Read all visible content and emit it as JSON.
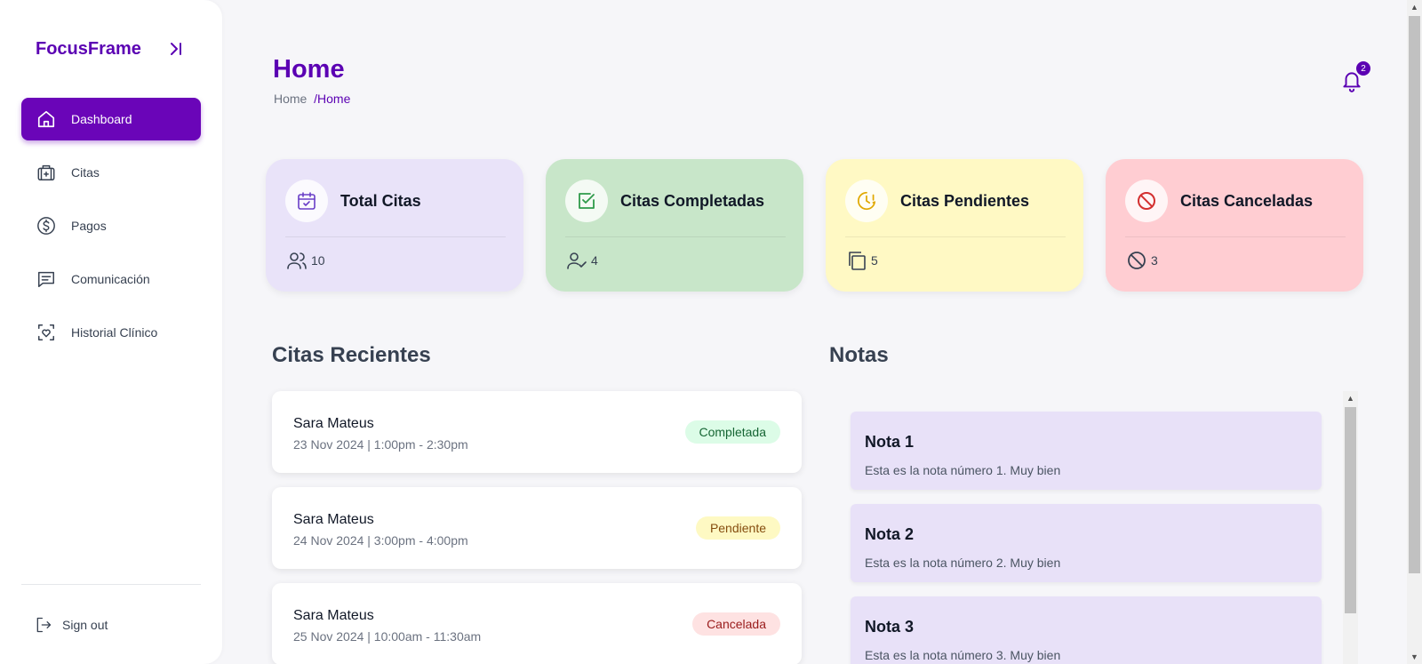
{
  "sidebar": {
    "brand": "FocusFrame",
    "items": [
      {
        "label": "Dashboard",
        "icon": "home-icon",
        "active": true
      },
      {
        "label": "Citas",
        "icon": "medical-bag-icon"
      },
      {
        "label": "Pagos",
        "icon": "dollar-circle-icon"
      },
      {
        "label": "Comunicación",
        "icon": "chat-icon"
      },
      {
        "label": "Historial Clínico",
        "icon": "heart-scan-icon"
      }
    ],
    "signout": "Sign out"
  },
  "header": {
    "title": "Home",
    "breadcrumb_root": "Home",
    "breadcrumb_sep": "/",
    "breadcrumb_current": "Home",
    "notifications_count": "2"
  },
  "stats": [
    {
      "title": "Total Citas",
      "value": "10",
      "bg": "#e9e3f9",
      "accent": "#6a3fc7",
      "icon": "calendar-check-icon",
      "foot_icon": "users-icon"
    },
    {
      "title": "Citas Completadas",
      "value": "4",
      "bg": "#c8e6c9",
      "accent": "#2e9a4a",
      "icon": "checkbox-icon",
      "foot_icon": "user-check-icon"
    },
    {
      "title": "Citas Pendientes",
      "value": "5",
      "bg": "#fff9c4",
      "accent": "#e0a800",
      "icon": "clock-alert-icon",
      "foot_icon": "copy-icon"
    },
    {
      "title": "Citas Canceladas",
      "value": "3",
      "bg": "#ffcdd2",
      "accent": "#d32f2f",
      "icon": "ban-icon",
      "foot_icon": "ban-icon"
    }
  ],
  "recent": {
    "title": "Citas Recientes",
    "items": [
      {
        "name": "Sara Mateus",
        "time": "23 Nov 2024 | 1:00pm - 2:30pm",
        "status": "Completada",
        "status_bg": "#dcfce7",
        "status_color": "#166534"
      },
      {
        "name": "Sara Mateus",
        "time": "24 Nov 2024 | 3:00pm - 4:00pm",
        "status": "Pendiente",
        "status_bg": "#fef9c3",
        "status_color": "#854d0e"
      },
      {
        "name": "Sara Mateus",
        "time": "25 Nov 2024 | 10:00am - 11:30am",
        "status": "Cancelada",
        "status_bg": "#fee2e2",
        "status_color": "#991b1b"
      }
    ]
  },
  "notes": {
    "title": "Notas",
    "items": [
      {
        "title": "Nota 1",
        "text": "Esta es la nota número 1. Muy bien"
      },
      {
        "title": "Nota 2",
        "text": "Esta es la nota número 2. Muy bien"
      },
      {
        "title": "Nota 3",
        "text": "Esta es la nota número 3. Muy bien"
      }
    ]
  }
}
